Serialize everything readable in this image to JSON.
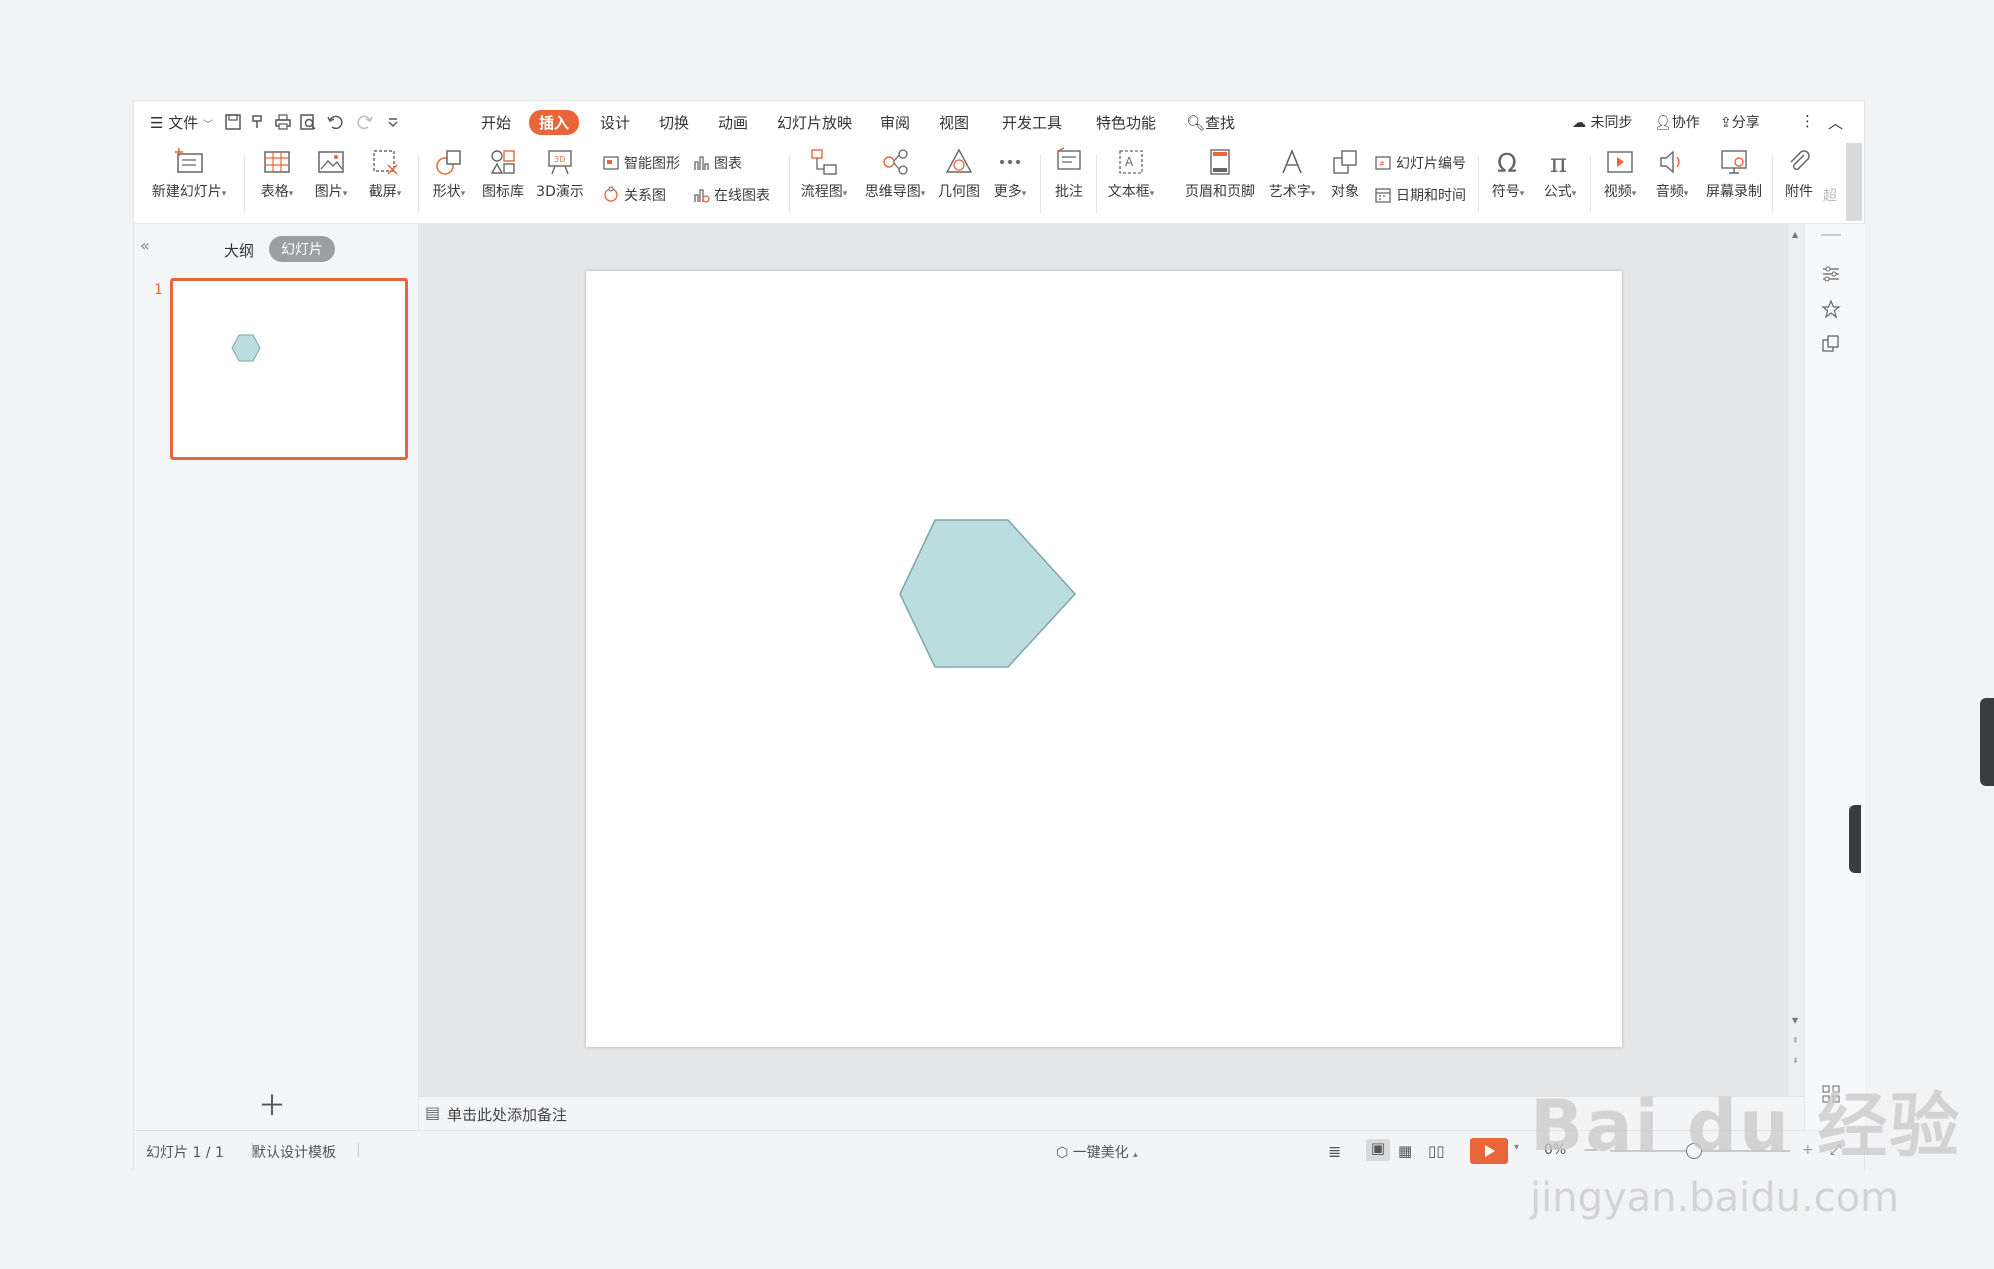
{
  "colors": {
    "accent": "#e8663a",
    "hexagon_fill": "#bcdde0",
    "hexagon_stroke": "#7ea6aa"
  },
  "menubar": {
    "file": "文件",
    "tabs": [
      "开始",
      "插入",
      "设计",
      "切换",
      "动画",
      "幻灯片放映",
      "审阅",
      "视图",
      "开发工具",
      "特色功能"
    ],
    "active_tab": "插入",
    "search": "查找",
    "sync": "未同步",
    "collab": "协作",
    "share": "分享"
  },
  "ribbon": {
    "new_slide": "新建幻灯片",
    "table": "表格",
    "picture": "图片",
    "screenshot": "截屏",
    "shape": "形状",
    "icon_lib": "图标库",
    "demo3d": "3D演示",
    "smart_art": "智能图形",
    "chart": "图表",
    "relation": "关系图",
    "online_chart": "在线图表",
    "flowchart": "流程图",
    "mindmap": "思维导图",
    "geometry": "几何图",
    "more": "更多",
    "comment": "批注",
    "textbox": "文本框",
    "header_footer": "页眉和页脚",
    "wordart": "艺术字",
    "object": "对象",
    "slide_number": "幻灯片编号",
    "datetime": "日期和时间",
    "symbol": "符号",
    "formula": "公式",
    "video": "视频",
    "audio": "音频",
    "screen_record": "屏幕录制",
    "attachment": "附件",
    "overflow": "超"
  },
  "leftpanel": {
    "tab_outline": "大纲",
    "tab_slides": "幻灯片",
    "slide_number": "1"
  },
  "notes": {
    "placeholder": "单击此处添加备注"
  },
  "statusbar": {
    "slide_count": "幻灯片 1 / 1",
    "template": "默认设计模板",
    "beautify": "一键美化",
    "zoom": "0%"
  },
  "watermark": {
    "logo": "Bai du 经验",
    "url": "jingyan.baidu.com"
  }
}
